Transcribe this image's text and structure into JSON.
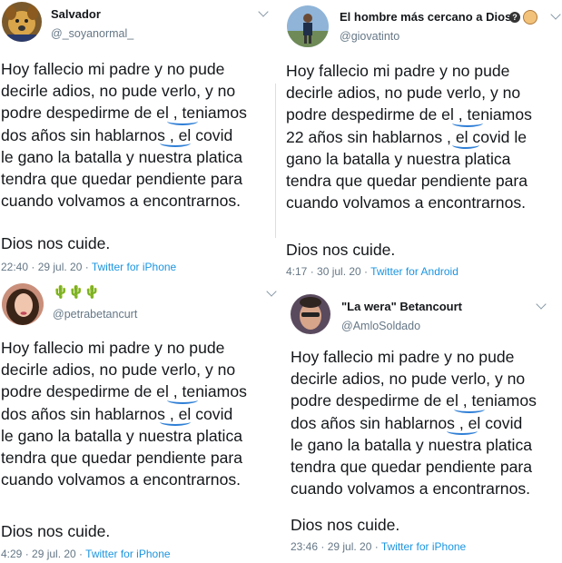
{
  "tweets": [
    {
      "name": "Salvador",
      "handle": "@_soyanormal_",
      "avatar_icon": "dog-avatar",
      "lines": [
        "Hoy fallecio mi padre y no pude",
        "decirle adios, no pude verlo, y no",
        "podre despedirme de el , teniamos",
        "dos años sin hablarnos , el covid",
        "le gano la batalla y nuestra platica",
        "tendra que quedar pendiente para",
        "cuando volvamos a encontrarnos."
      ],
      "closing": "Dios nos cuide.",
      "time": "22:40 · 29 jul. 20 · ",
      "source": "Twitter for iPhone"
    },
    {
      "name": "El hombre más cercano a Dios.",
      "handle": "@giovatinto",
      "avatar_icon": "person-avatar",
      "lines": [
        "Hoy fallecio mi padre y no pude",
        "decirle adios, no pude verlo, y no",
        "podre despedirme de el , teniamos",
        "22 años sin hablarnos , el covid le",
        "gano la batalla y nuestra platica",
        "tendra que quedar pendiente para",
        "cuando volvamos a encontrarnos."
      ],
      "closing": "Dios nos cuide.",
      "time": "4:17 · 30 jul. 20 · ",
      "source": "Twitter for Android"
    },
    {
      "name": "🌵🌵🌵",
      "handle": "@petrabetancurt",
      "avatar_icon": "woman-avatar",
      "lines": [
        "Hoy fallecio mi padre y no pude",
        "decirle adios, no pude verlo, y no",
        "podre despedirme de el , teniamos",
        "dos años sin hablarnos , el covid",
        "le gano la batalla y nuestra platica",
        "tendra que quedar pendiente para",
        "cuando volvamos a encontrarnos."
      ],
      "closing": "Dios nos cuide.",
      "time": "4:29 · 29 jul. 20 · ",
      "source": "Twitter for iPhone"
    },
    {
      "name": "\"La wera\" Betancourt",
      "handle": "@AmloSoldado",
      "avatar_icon": "man-avatar",
      "lines": [
        "Hoy fallecio mi padre y no pude",
        "decirle adios, no pude verlo, y no",
        "podre despedirme de el , teniamos",
        "dos años sin hablarnos , el covid",
        "le gano la batalla y nuestra platica",
        "tendra que quedar pendiente para",
        "cuando volvamos a encontrarnos."
      ],
      "closing": "Dios nos cuide.",
      "time": "23:46 · 29 jul. 20 · ",
      "source": "Twitter for iPhone"
    }
  ],
  "colors": {
    "link": "#1b95e0",
    "muted": "#657786",
    "text": "#14171a",
    "mark": "#2f7fd6"
  }
}
